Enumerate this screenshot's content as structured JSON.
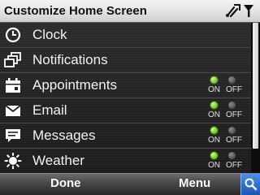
{
  "header": {
    "title": "Customize Home Screen",
    "status_icons": [
      "connectivity-icon",
      "signal-icon"
    ]
  },
  "items": [
    {
      "label": "Clock",
      "icon": "clock-icon",
      "has_toggle": false
    },
    {
      "label": "Notifications",
      "icon": "notifications-icon",
      "has_toggle": false
    },
    {
      "label": "Appointments",
      "icon": "calendar-icon",
      "has_toggle": true,
      "state": "ON"
    },
    {
      "label": "Email",
      "icon": "envelope-icon",
      "has_toggle": true,
      "state": "ON"
    },
    {
      "label": "Messages",
      "icon": "speech-bubble-icon",
      "has_toggle": true,
      "state": "ON"
    },
    {
      "label": "Weather",
      "icon": "sun-icon",
      "has_toggle": true,
      "state": "ON"
    }
  ],
  "toggle_labels": {
    "on": "ON",
    "off": "OFF"
  },
  "softkeys": {
    "left": "Done",
    "right": "Menu"
  },
  "colors": {
    "on_indicator": "#7ED321",
    "off_indicator": "#5A5A5A",
    "title_bar": "#E6E6E6",
    "list_background": "#222222",
    "search_button": "#2A6BD0"
  }
}
